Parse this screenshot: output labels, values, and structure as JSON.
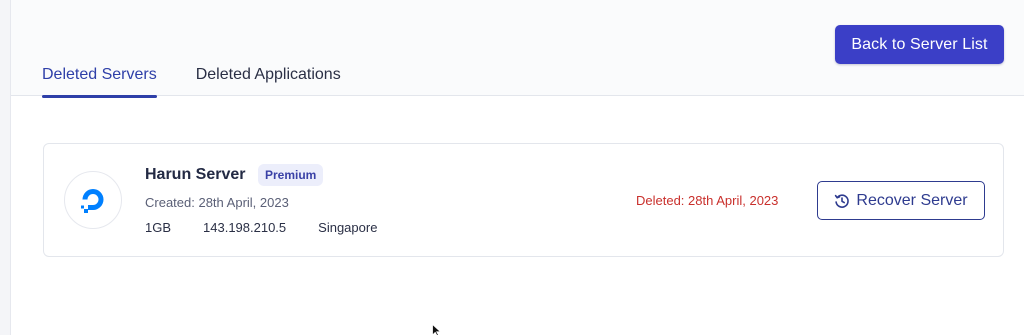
{
  "header": {
    "back_button_label": "Back to Server List",
    "tabs": [
      {
        "label": "Deleted Servers",
        "active": true
      },
      {
        "label": "Deleted Applications",
        "active": false
      }
    ]
  },
  "server_card": {
    "logo_icon": "digitalocean-logo-icon",
    "name": "Harun Server",
    "plan_badge": "Premium",
    "created": "Created: 28th April, 2023",
    "memory": "1GB",
    "ip_address": "143.198.210.5",
    "region": "Singapore",
    "deleted": "Deleted: 28th April, 2023",
    "recover_button_label": "Recover Server",
    "recover_icon": "history-restore-icon"
  },
  "colors": {
    "primary": "#3b3fc7",
    "tab_active": "#2e3fa8",
    "danger_text": "#c9302c",
    "logo_blue": "#0080ff",
    "badge_bg": "#eceefb"
  }
}
